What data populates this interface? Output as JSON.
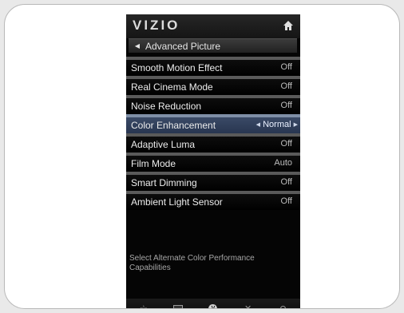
{
  "header": {
    "brand": "VIZIO"
  },
  "breadcrumb": {
    "label": "Advanced Picture"
  },
  "menu": {
    "items": [
      {
        "label": "Smooth Motion Effect",
        "value": "Off"
      },
      {
        "label": "Real Cinema Mode",
        "value": "Off"
      },
      {
        "label": "Noise Reduction",
        "value": "Off"
      },
      {
        "label": "Color Enhancement",
        "value": "Normal",
        "selected": true
      },
      {
        "label": "Adaptive Luma",
        "value": "Off"
      },
      {
        "label": "Film Mode",
        "value": "Auto"
      },
      {
        "label": "Smart Dimming",
        "value": "Off"
      },
      {
        "label": "Ambient Light Sensor",
        "value": "Off"
      }
    ]
  },
  "description": "Select Alternate Color Performance Capabilities",
  "bottom_bar": {
    "buttons": [
      {
        "icon": "star-icon",
        "symbol": "☆"
      },
      {
        "icon": "input-icon",
        "symbol": ""
      },
      {
        "icon": "vizio-v-icon",
        "symbol": "V"
      },
      {
        "icon": "close-icon",
        "symbol": "✕"
      },
      {
        "icon": "settings-icon",
        "symbol": ""
      }
    ]
  },
  "colors": {
    "screen_bg": "#050505",
    "selected_bg": "#2f3e5a",
    "divider": "#5a5a5a",
    "active_indicator": "#c5283c"
  }
}
